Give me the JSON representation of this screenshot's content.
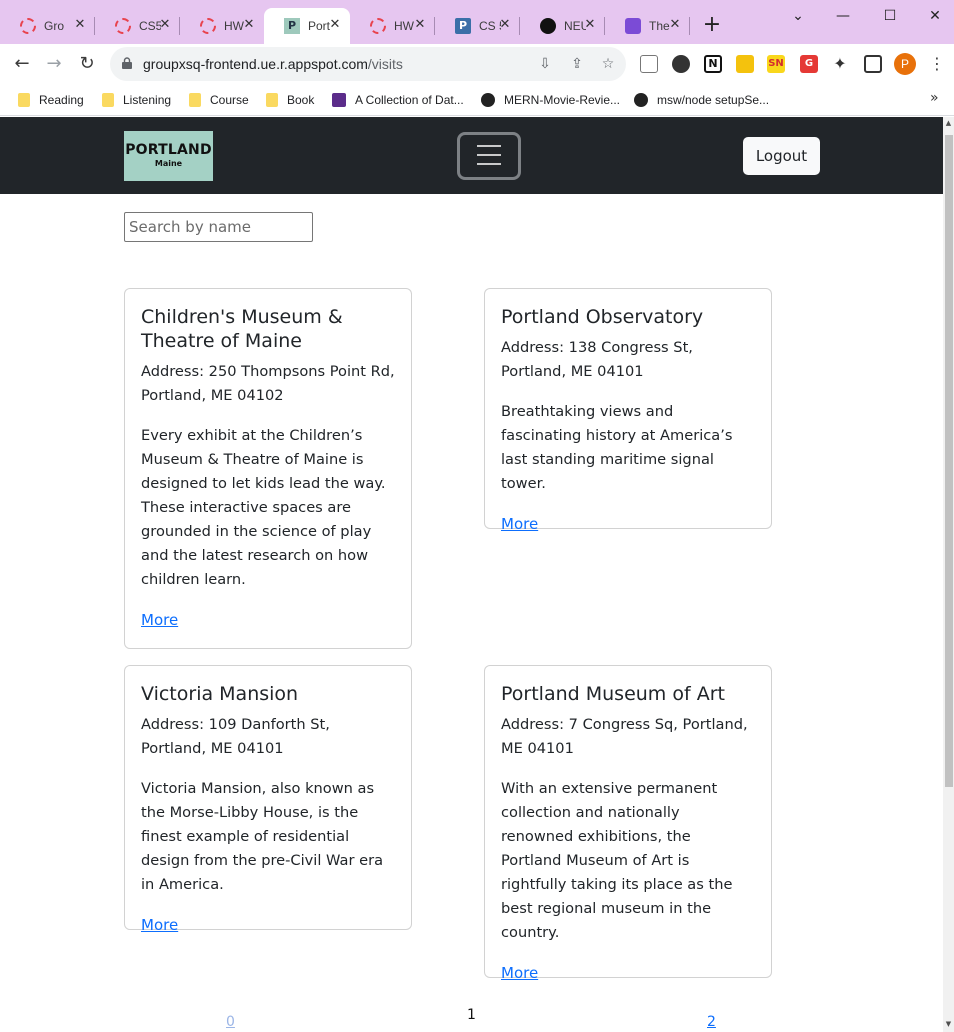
{
  "browser": {
    "tabs": [
      {
        "title": "Gro",
        "favicon": "dashed-ring-icon"
      },
      {
        "title": "CS5",
        "favicon": "dashed-ring-icon"
      },
      {
        "title": "HW",
        "favicon": "dashed-ring-icon"
      },
      {
        "title": "Port",
        "favicon": "p-logo-icon",
        "active": true
      },
      {
        "title": "HW",
        "favicon": "dashed-ring-icon"
      },
      {
        "title": "CS 5",
        "favicon": "p-square-icon"
      },
      {
        "title": "NEU",
        "favicon": "github-icon"
      },
      {
        "title": "The",
        "favicon": "purple-app-icon"
      }
    ],
    "url_host": "groupxsq-frontend.ue.r.appspot.com",
    "url_path": "/visits",
    "profile_initial": "P",
    "bookmarks": [
      {
        "label": "Reading",
        "icon": "folder-icon"
      },
      {
        "label": "Listening",
        "icon": "folder-icon"
      },
      {
        "label": "Course",
        "icon": "folder-icon"
      },
      {
        "label": "Book",
        "icon": "folder-icon"
      },
      {
        "label": "A Collection of Dat...",
        "icon": "flag-icon"
      },
      {
        "label": "MERN-Movie-Revie...",
        "icon": "github-icon"
      },
      {
        "label": "msw/node setupSe...",
        "icon": "globe-icon"
      }
    ],
    "extensions": {
      "sn": "SN",
      "g": "G"
    }
  },
  "page": {
    "logo": {
      "line1": "PORTLAND",
      "line2": "Maine"
    },
    "logout_label": "Logout",
    "search_placeholder": "Search by name",
    "cards": [
      {
        "title": "Children's Museum & Theatre of Maine",
        "address": "Address: 250 Thompsons Point Rd, Portland, ME 04102",
        "description": "Every exhibit at the Children’s Museum & Theatre of Maine is designed to let kids lead the way. These interactive spaces are grounded in the science of play and the latest research on how children learn.",
        "link": "More"
      },
      {
        "title": "Portland Observatory",
        "address": "Address: 138 Congress St, Portland, ME 04101",
        "description": "Breathtaking views and fascinating history at America’s last standing maritime signal tower.",
        "link": "More"
      },
      {
        "title": "Victoria Mansion",
        "address": "Address: 109 Danforth St, Portland, ME 04101",
        "description": "Victoria Mansion, also known as the Morse-Libby House, is the finest example of residential design from the pre-Civil War era in America.",
        "link": "More"
      },
      {
        "title": "Portland Museum of Art",
        "address": "Address: 7 Congress Sq, Portland, ME 04101",
        "description": "With an extensive permanent collection and nationally renowned exhibitions, the Portland Museum of Art is rightfully taking its place as the best regional museum in the country.",
        "link": "More"
      }
    ],
    "pagination": {
      "prev": "0",
      "current": "1",
      "next": "2"
    }
  },
  "colors": {
    "navbar": "#212529",
    "link": "#0d6efd",
    "tabstrip": "#e6c6f0",
    "logo_bg": "#a4d1c5"
  }
}
